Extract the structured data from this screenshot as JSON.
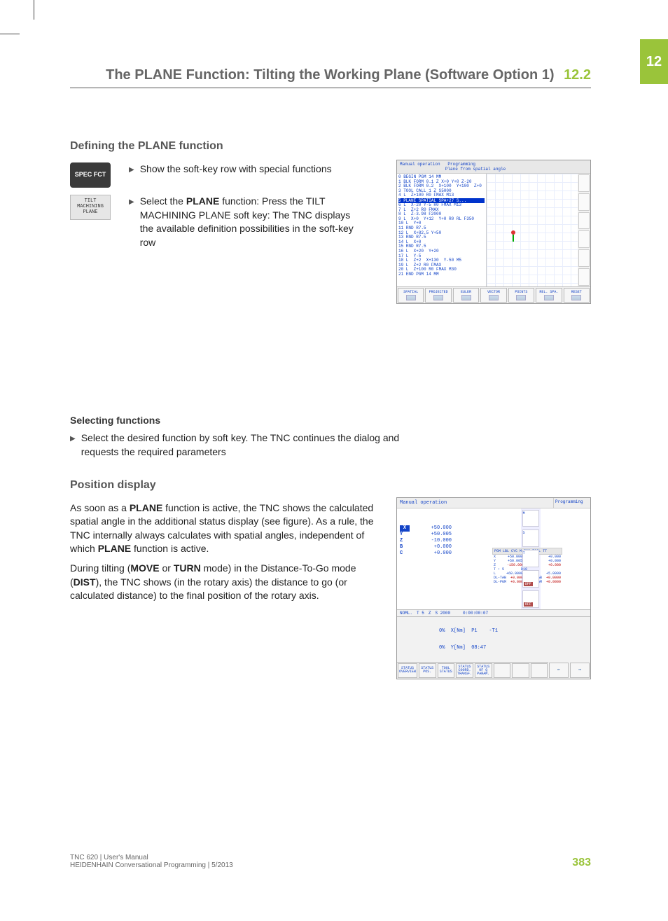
{
  "chapter": "12",
  "header": {
    "title": "The PLANE Function: Tilting the Working Plane (Software Option 1)",
    "section": "12.2"
  },
  "sec1": {
    "heading": "Defining the PLANE function",
    "key1": "SPEC FCT",
    "key2": "TILT MACHINING PLANE",
    "bullet1": "Show the soft-key row with special functions",
    "bullet2_a": "Select the ",
    "bullet2_b": "PLANE",
    "bullet2_c": " function: Press the TILT MACHINING PLANE soft key: The TNC displays the available definition possibilities in the soft-key row"
  },
  "scr1": {
    "titleL": "Manual operation",
    "titleR1": "Programming",
    "titleR2": "Plane from spatial angle",
    "code": [
      "0 BEGIN PGM 14 MM",
      "1 BLK FORM 0.1 Z X+0 Y+0 Z-20",
      "2 BLK FORM 0.2  X+100  Y+100  Z+0",
      "3 TOOL CALL 1 Z S5000",
      "4 L  Z+100 R0 FMAX M13",
      "5 PLANE SPATIAL SPA+27 S...",
      "6 L  X-20 Y-5 R0 FMAX M13",
      "7 L  Z+2 R0 FMAX",
      "8 L  Z-3.98 F2000",
      "9 L  X+0  Y+12  Y+0 R0 RL F350",
      "10 L  Y+0",
      "11 RND R7.5",
      "12 L  X+82.5 Y+50",
      "13 RND R7.5",
      "14 L  X+0",
      "15 RND R7.5",
      "16 L  X+20  Y+20",
      "17 L  Y-5",
      "18 L  Z+2  X+130  Y-50 M5",
      "19 L  Z+2 R0 FMAX",
      "20 L  Z+100 R0 FMAX M30",
      "21 END PGM 14 MM"
    ],
    "softkeys": [
      "SPATIAL",
      "PROJECTED",
      "EULER",
      "VECTOR",
      "POINTS",
      "REL. SPA.",
      "RESET"
    ]
  },
  "sec2": {
    "heading": "Selecting functions",
    "bullet": "Select the desired function by soft key. The TNC continues the dialog and requests the required parameters"
  },
  "sec3": {
    "heading": "Position display",
    "p1_a": "As soon as a ",
    "p1_b": "PLANE",
    "p1_c": " function is active, the TNC shows the calculated spatial angle in the additional status display (see figure). As a rule, the TNC internally always calculates with spatial angles, independent of which ",
    "p1_d": "PLANE",
    "p1_e": " function is active.",
    "p2_a": "During tilting (",
    "p2_b": "MOVE",
    "p2_c": " or ",
    "p2_d": "TURN",
    "p2_e": " mode) in the Distance-To-Go mode (",
    "p2_f": "DIST",
    "p2_g": "), the TNC shows (in the rotary axis) the distance to go (or calculated distance) to the final position of the rotary axis."
  },
  "scr2": {
    "title": "Manual operation",
    "mode": "Programming",
    "axes": [
      {
        "lab": "X",
        "val": "+50.000",
        "inv": true
      },
      {
        "lab": "Y",
        "val": "+50.005"
      },
      {
        "lab": "Z",
        "val": "-10.000"
      },
      {
        "lab": "B",
        "val": "+0.000"
      },
      {
        "lab": "C",
        "val": "+0.000"
      }
    ],
    "info_tabs": [
      "PGM",
      "LBL",
      "CYC",
      "M",
      "POS",
      "TOOL",
      "TT"
    ],
    "info_rows": [
      {
        "l": "X",
        "v1": "+50.000",
        "r": "B",
        "v2": "+0.000",
        "vneg": false
      },
      {
        "l": "Y",
        "v1": "+50.005",
        "r": "B",
        "v2": "+0.000",
        "vneg": false
      },
      {
        "l": "Z",
        "v1": "-150.000",
        "r": "C",
        "v2": "+0.000",
        "vneg": true
      },
      {
        "l": "T : 5",
        "v1": "D10",
        "r": "",
        "v2": "",
        "vneg": false
      },
      {
        "l": "L",
        "v1": "+60.0000",
        "r": "R",
        "v2": "+5.0000",
        "vneg": false
      },
      {
        "l": "DL-TAB",
        "v1": "+0.0000",
        "r": "DR-TAB",
        "v2": "+0.0000",
        "vneg": true
      },
      {
        "l": "DL-PGM",
        "v1": "+0.0000",
        "r": "DR-PGM",
        "v2": "+0.0000",
        "vneg": true
      }
    ],
    "foot1": [
      "NOML.",
      "T 5",
      "Z",
      "S 2000",
      "",
      "",
      "0:00:00:07"
    ],
    "foot2a": "0%  X[Nm]  P1    -T1",
    "foot2b": "0%  Y[Nm]  08:47",
    "softkeys": [
      "STATUS OVERVIEW",
      "STATUS POS.",
      "TOOL STATUS",
      "STATUS COORD. TRANSF.",
      "STATUS OF Q PARAM.",
      "",
      "",
      ""
    ]
  },
  "footer": {
    "line1": "TNC 620 | User's Manual",
    "line2": "HEIDENHAIN Conversational Programming | 5/2013",
    "page": "383"
  }
}
